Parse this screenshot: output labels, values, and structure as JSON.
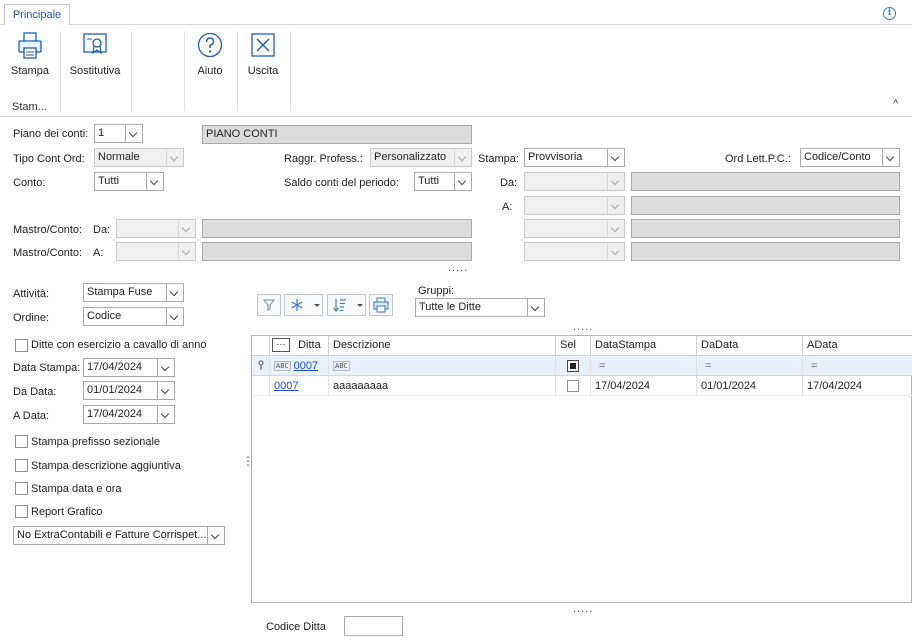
{
  "ribbon": {
    "tab": "Principale",
    "buttons": {
      "stampa": "Stampa",
      "sostitutiva": "Sostitutiva",
      "aiuto": "Aiuto",
      "uscita": "Uscita"
    },
    "group_label": "Stam...",
    "collapse_glyph": "^",
    "info_glyph": "i"
  },
  "form": {
    "piano_label": "Piano dei conti:",
    "piano_value": "1",
    "piano_desc": "PIANO CONTI",
    "tipo_label": "Tipo Cont Ord:",
    "tipo_value": "Normale",
    "raggr_label": "Raggr. Profess.:",
    "raggr_value": "Personalizzato",
    "stampa_label": "Stampa:",
    "stampa_value": "Provvisoria",
    "ord_label": "Ord Lett.P.C.:",
    "ord_value": "Codice/Conto",
    "conto_label": "Conto:",
    "conto_value": "Tutti",
    "saldo_label": "Saldo conti del periodo:",
    "saldo_value": "Tutti",
    "da_label": "Da:",
    "a_label": "A:",
    "mastro_da_label": "Mastro/Conto:",
    "mastro_da_sub": "Da:",
    "mastro_a_label": "Mastro/Conto:",
    "mastro_a_sub": "A:",
    "dots": "....."
  },
  "left": {
    "attivita_label": "Attività:",
    "attivita_value": "Stampa Fuse",
    "ordine_label": "Ordine:",
    "ordine_value": "Codice",
    "ditte_chk": "Ditte con esercizio a cavallo di anno",
    "data_stampa_label": "Data Stampa:",
    "data_stampa_value": "17/04/2024",
    "da_data_label": "Da Data:",
    "da_data_value": "01/01/2024",
    "a_data_label": "A Data:",
    "a_data_value": "17/04/2024",
    "chk_prefisso": "Stampa prefisso sezionale",
    "chk_descrizione": "Stampa descrizione aggiuntiva",
    "chk_data_ora": "Stampa data e ora",
    "chk_report": "Report Grafico",
    "extra_value": "No ExtraContabili e Fatture Corrispet...",
    "splitter": "⋮"
  },
  "gruppi": {
    "label": "Gruppi:",
    "value": "Tutte le Ditte"
  },
  "grid": {
    "dots_top": ".....",
    "dots_bottom": ".....",
    "columns": {
      "menu": "···",
      "ditta": "Ditta",
      "descrizione": "Descrizione",
      "sel": "Sel",
      "datastampa": "DataStampa",
      "dadata": "DaData",
      "adata": "AData"
    },
    "filter": {
      "ditta": "0007",
      "abc": "ABC",
      "eq": "="
    },
    "rows": [
      {
        "ditta": "0007",
        "descrizione": "aaaaaaaaa",
        "datastampa": "17/04/2024",
        "dadata": "01/01/2024",
        "adata": "17/04/2024"
      }
    ]
  },
  "footer": {
    "codice_ditta_label": "Codice Ditta",
    "codice_ditta_value": ""
  }
}
